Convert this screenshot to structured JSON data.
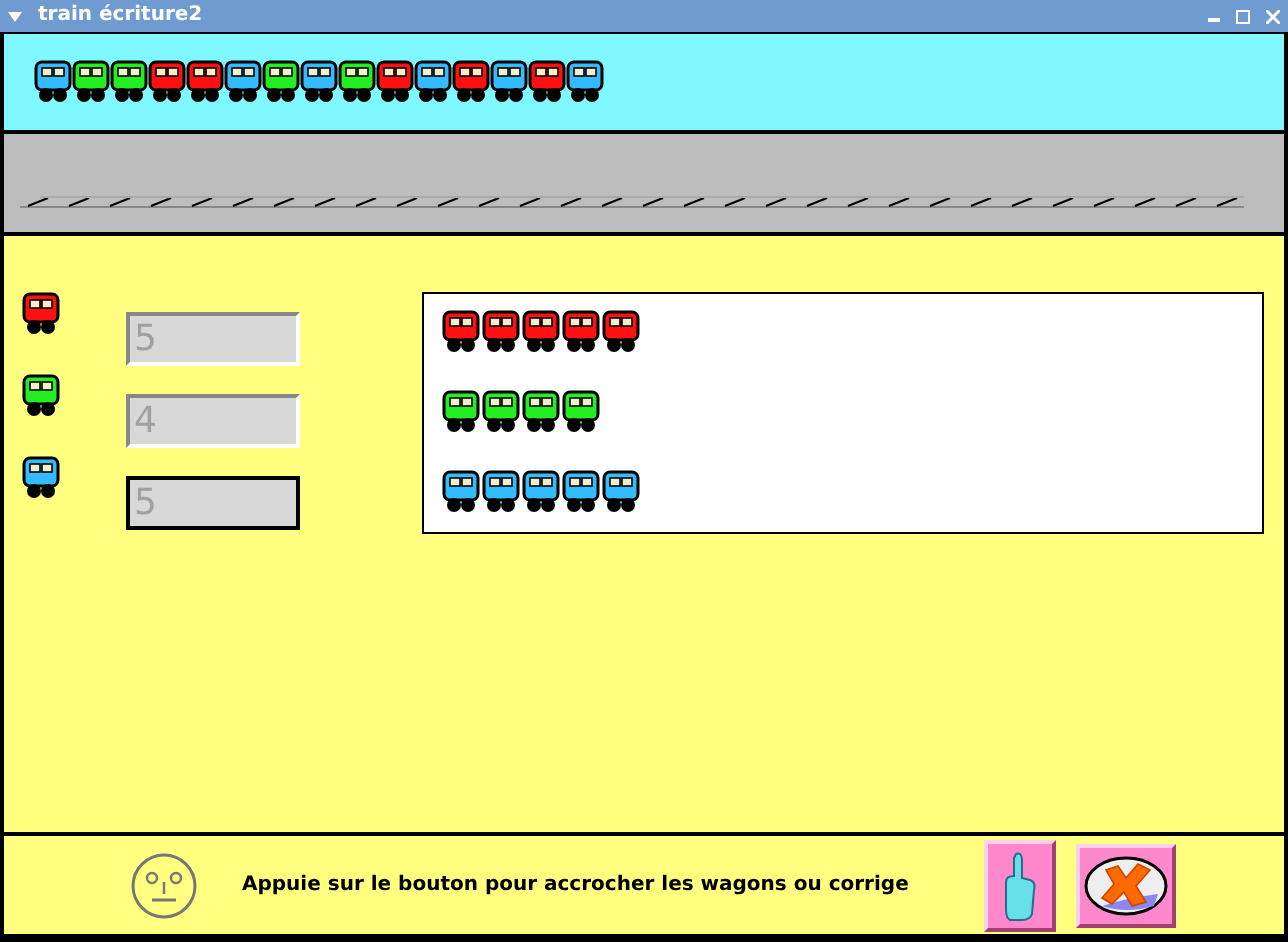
{
  "window": {
    "title": "train écriture2"
  },
  "train": [
    {
      "color": "#33bbff"
    },
    {
      "color": "#22ee22"
    },
    {
      "color": "#22ee22"
    },
    {
      "color": "#ff1111"
    },
    {
      "color": "#ff1111"
    },
    {
      "color": "#33bbff"
    },
    {
      "color": "#22ee22"
    },
    {
      "color": "#33bbff"
    },
    {
      "color": "#22ee22"
    },
    {
      "color": "#ff1111"
    },
    {
      "color": "#33bbff"
    },
    {
      "color": "#ff1111"
    },
    {
      "color": "#33bbff"
    },
    {
      "color": "#ff1111"
    },
    {
      "color": "#33bbff"
    }
  ],
  "inputs": [
    {
      "color": "#ff1111",
      "value": "5",
      "focused": false
    },
    {
      "color": "#22ee22",
      "value": "4",
      "focused": false
    },
    {
      "color": "#33bbff",
      "value": "5",
      "focused": true
    }
  ],
  "answer_rows": [
    {
      "wagons": [
        {
          "color": "#ff1111"
        },
        {
          "color": "#ff1111"
        },
        {
          "color": "#ff1111"
        },
        {
          "color": "#ff1111"
        },
        {
          "color": "#ff1111"
        }
      ]
    },
    {
      "wagons": [
        {
          "color": "#22ee22"
        },
        {
          "color": "#22ee22"
        },
        {
          "color": "#22ee22"
        },
        {
          "color": "#22ee22"
        }
      ]
    },
    {
      "wagons": [
        {
          "color": "#33bbff"
        },
        {
          "color": "#33bbff"
        },
        {
          "color": "#33bbff"
        },
        {
          "color": "#33bbff"
        },
        {
          "color": "#33bbff"
        }
      ]
    }
  ],
  "status": {
    "message": "Appuie sur le bouton pour accrocher les wagons ou corrige"
  }
}
